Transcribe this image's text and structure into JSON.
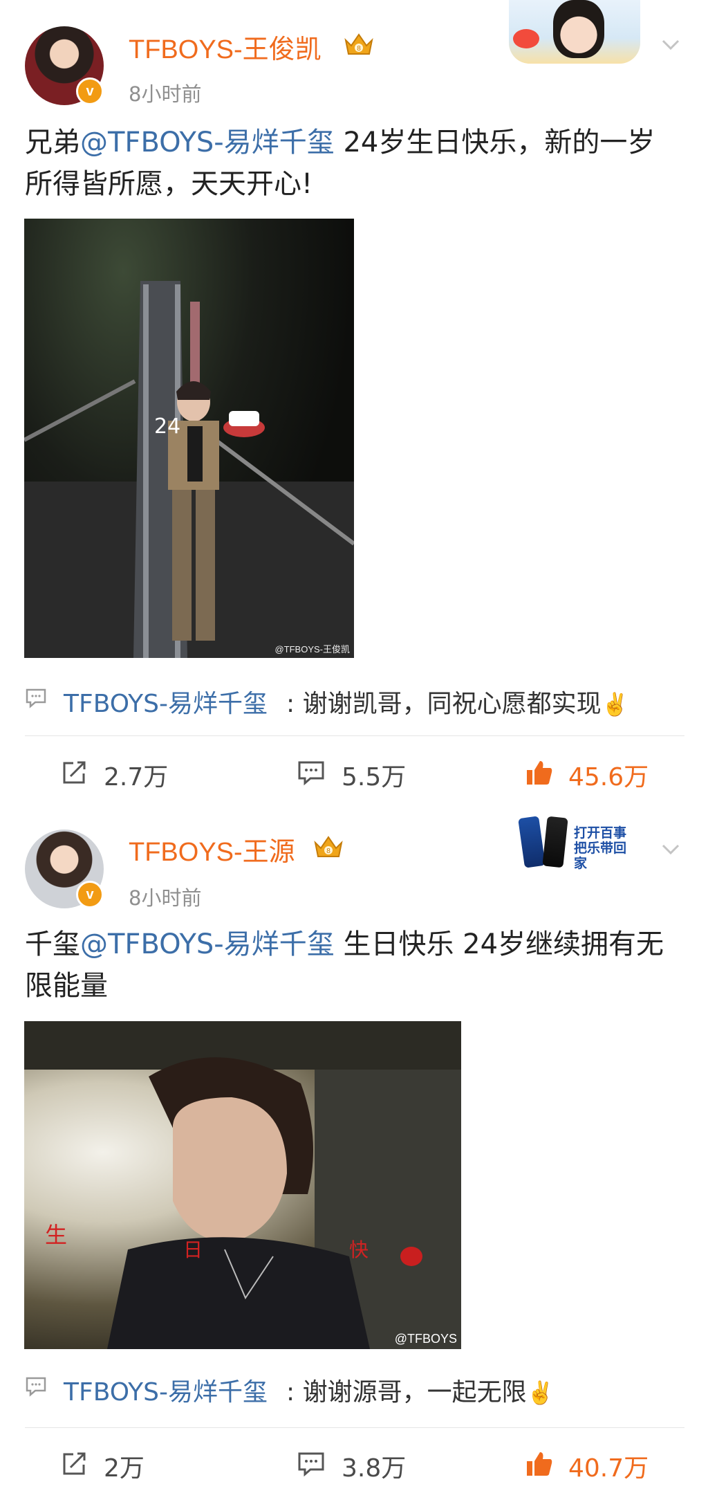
{
  "posts": [
    {
      "author": "TFBOYS-王俊凯",
      "time": "8小时前",
      "text_prefix": "兄弟",
      "mention": "@TFBOYS-易烊千玺",
      "text_suffix": " 24岁生日快乐，新的一岁所得皆所愿，天天开心!",
      "image_watermark": "@TFBOYS-王俊凯",
      "comment_user": "TFBOYS-易烊千玺",
      "comment_text": ": 谢谢凯哥，同祝心愿都实现",
      "comment_emoji": "✌️",
      "reposts": "2.7万",
      "comments": "5.5万",
      "likes": "45.6万",
      "avatar_badge": "v"
    },
    {
      "author": "TFBOYS-王源",
      "time": "8小时前",
      "text_prefix": "千玺",
      "mention": "@TFBOYS-易烊千玺",
      "text_suffix": " 生日快乐 24岁继续拥有无限能量",
      "image_watermark": "@TFBOYS",
      "comment_user": "TFBOYS-易烊千玺",
      "comment_text": ": 谢谢源哥，一起无限",
      "comment_emoji": "✌️",
      "reposts": "2万",
      "comments": "3.8万",
      "likes": "40.7万",
      "avatar_badge": "v",
      "ad_text": "打开百事 把乐带回家"
    }
  ],
  "colors": {
    "name": "#f06b1d",
    "mention": "#3c6ea8",
    "like": "#f06b1d",
    "time": "#8f8f8f"
  },
  "icons": {
    "repost": "repost-icon",
    "comment": "comment-icon",
    "like": "thumbs-up-icon",
    "menu": "chevron-down-icon",
    "crown": "crown-badge-icon",
    "verified": "verified-v-icon"
  }
}
